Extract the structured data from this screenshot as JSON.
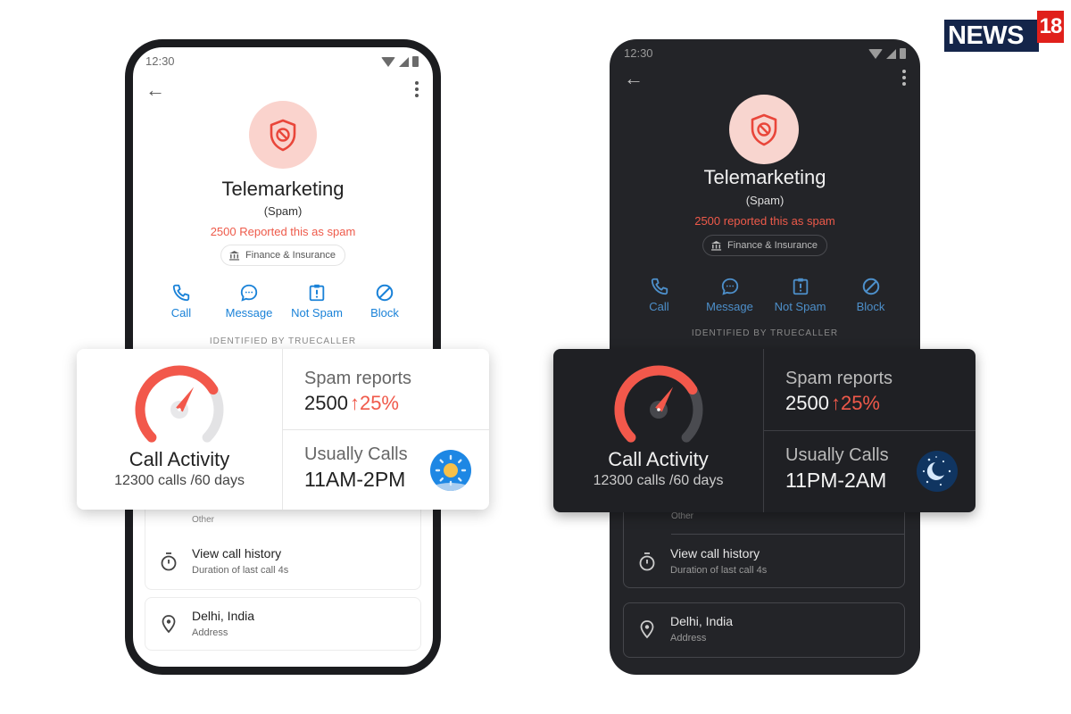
{
  "logo": {
    "text": "NEWS",
    "number": "18"
  },
  "colors": {
    "accent_red": "#f0594a",
    "link_blue": "#1a82d8",
    "avatar_bg": "#fad3cd",
    "logo_navy": "#14254a",
    "logo_red": "#e0201b"
  },
  "light_phone": {
    "status": {
      "time": "12:30"
    },
    "caller": {
      "name": "Telemarketing",
      "type": "(Spam)",
      "spam_count_text": "2500 Reported this as spam",
      "category": "Finance & Insurance"
    },
    "actions": [
      {
        "label": "Call",
        "icon": "phone-icon"
      },
      {
        "label": "Message",
        "icon": "message-icon"
      },
      {
        "label": "Not Spam",
        "icon": "not-spam-icon"
      },
      {
        "label": "Block",
        "icon": "block-icon"
      }
    ],
    "identified_by": "IDENTIFIED BY TRUECALLER",
    "partial_row_label": "Other",
    "list": [
      {
        "title": "View call history",
        "subtitle": "Duration of last call 4s",
        "icon": "stopwatch-icon"
      },
      {
        "title": "Delhi, India",
        "subtitle": "Address",
        "icon": "location-pin-icon"
      }
    ]
  },
  "dark_phone": {
    "status": {
      "time": "12:30"
    },
    "caller": {
      "name": "Telemarketing",
      "type": "(Spam)",
      "spam_count_text": "2500 reported this as spam",
      "category": "Finance & Insurance"
    },
    "actions": [
      {
        "label": "Call",
        "icon": "phone-icon"
      },
      {
        "label": "Message",
        "icon": "message-icon"
      },
      {
        "label": "Not Spam",
        "icon": "not-spam-icon"
      },
      {
        "label": "Block",
        "icon": "block-icon"
      }
    ],
    "identified_by": "IDENTIFIED BY TRUECALLER",
    "partial_row_label": "Other",
    "list": [
      {
        "title": "View call history",
        "subtitle": "Duration of last call 4s",
        "icon": "stopwatch-icon"
      },
      {
        "title": "Delhi, India",
        "subtitle": "Address",
        "icon": "location-pin-icon"
      }
    ]
  },
  "light_card": {
    "call_activity": {
      "title": "Call Activity",
      "subtitle": "12300 calls /60 days",
      "gauge_level": 0.72
    },
    "spam_reports": {
      "label": "Spam reports",
      "value": "2500",
      "trend": "↑25%"
    },
    "usually_calls": {
      "label": "Usually Calls",
      "value": "11AM-2PM",
      "icon": "sun-icon"
    }
  },
  "dark_card": {
    "call_activity": {
      "title": "Call Activity",
      "subtitle": "12300 calls /60 days",
      "gauge_level": 0.72
    },
    "spam_reports": {
      "label": "Spam reports",
      "value": "2500",
      "trend": "↑25%"
    },
    "usually_calls": {
      "label": "Usually Calls",
      "value": "11PM-2AM",
      "icon": "moon-icon"
    }
  }
}
